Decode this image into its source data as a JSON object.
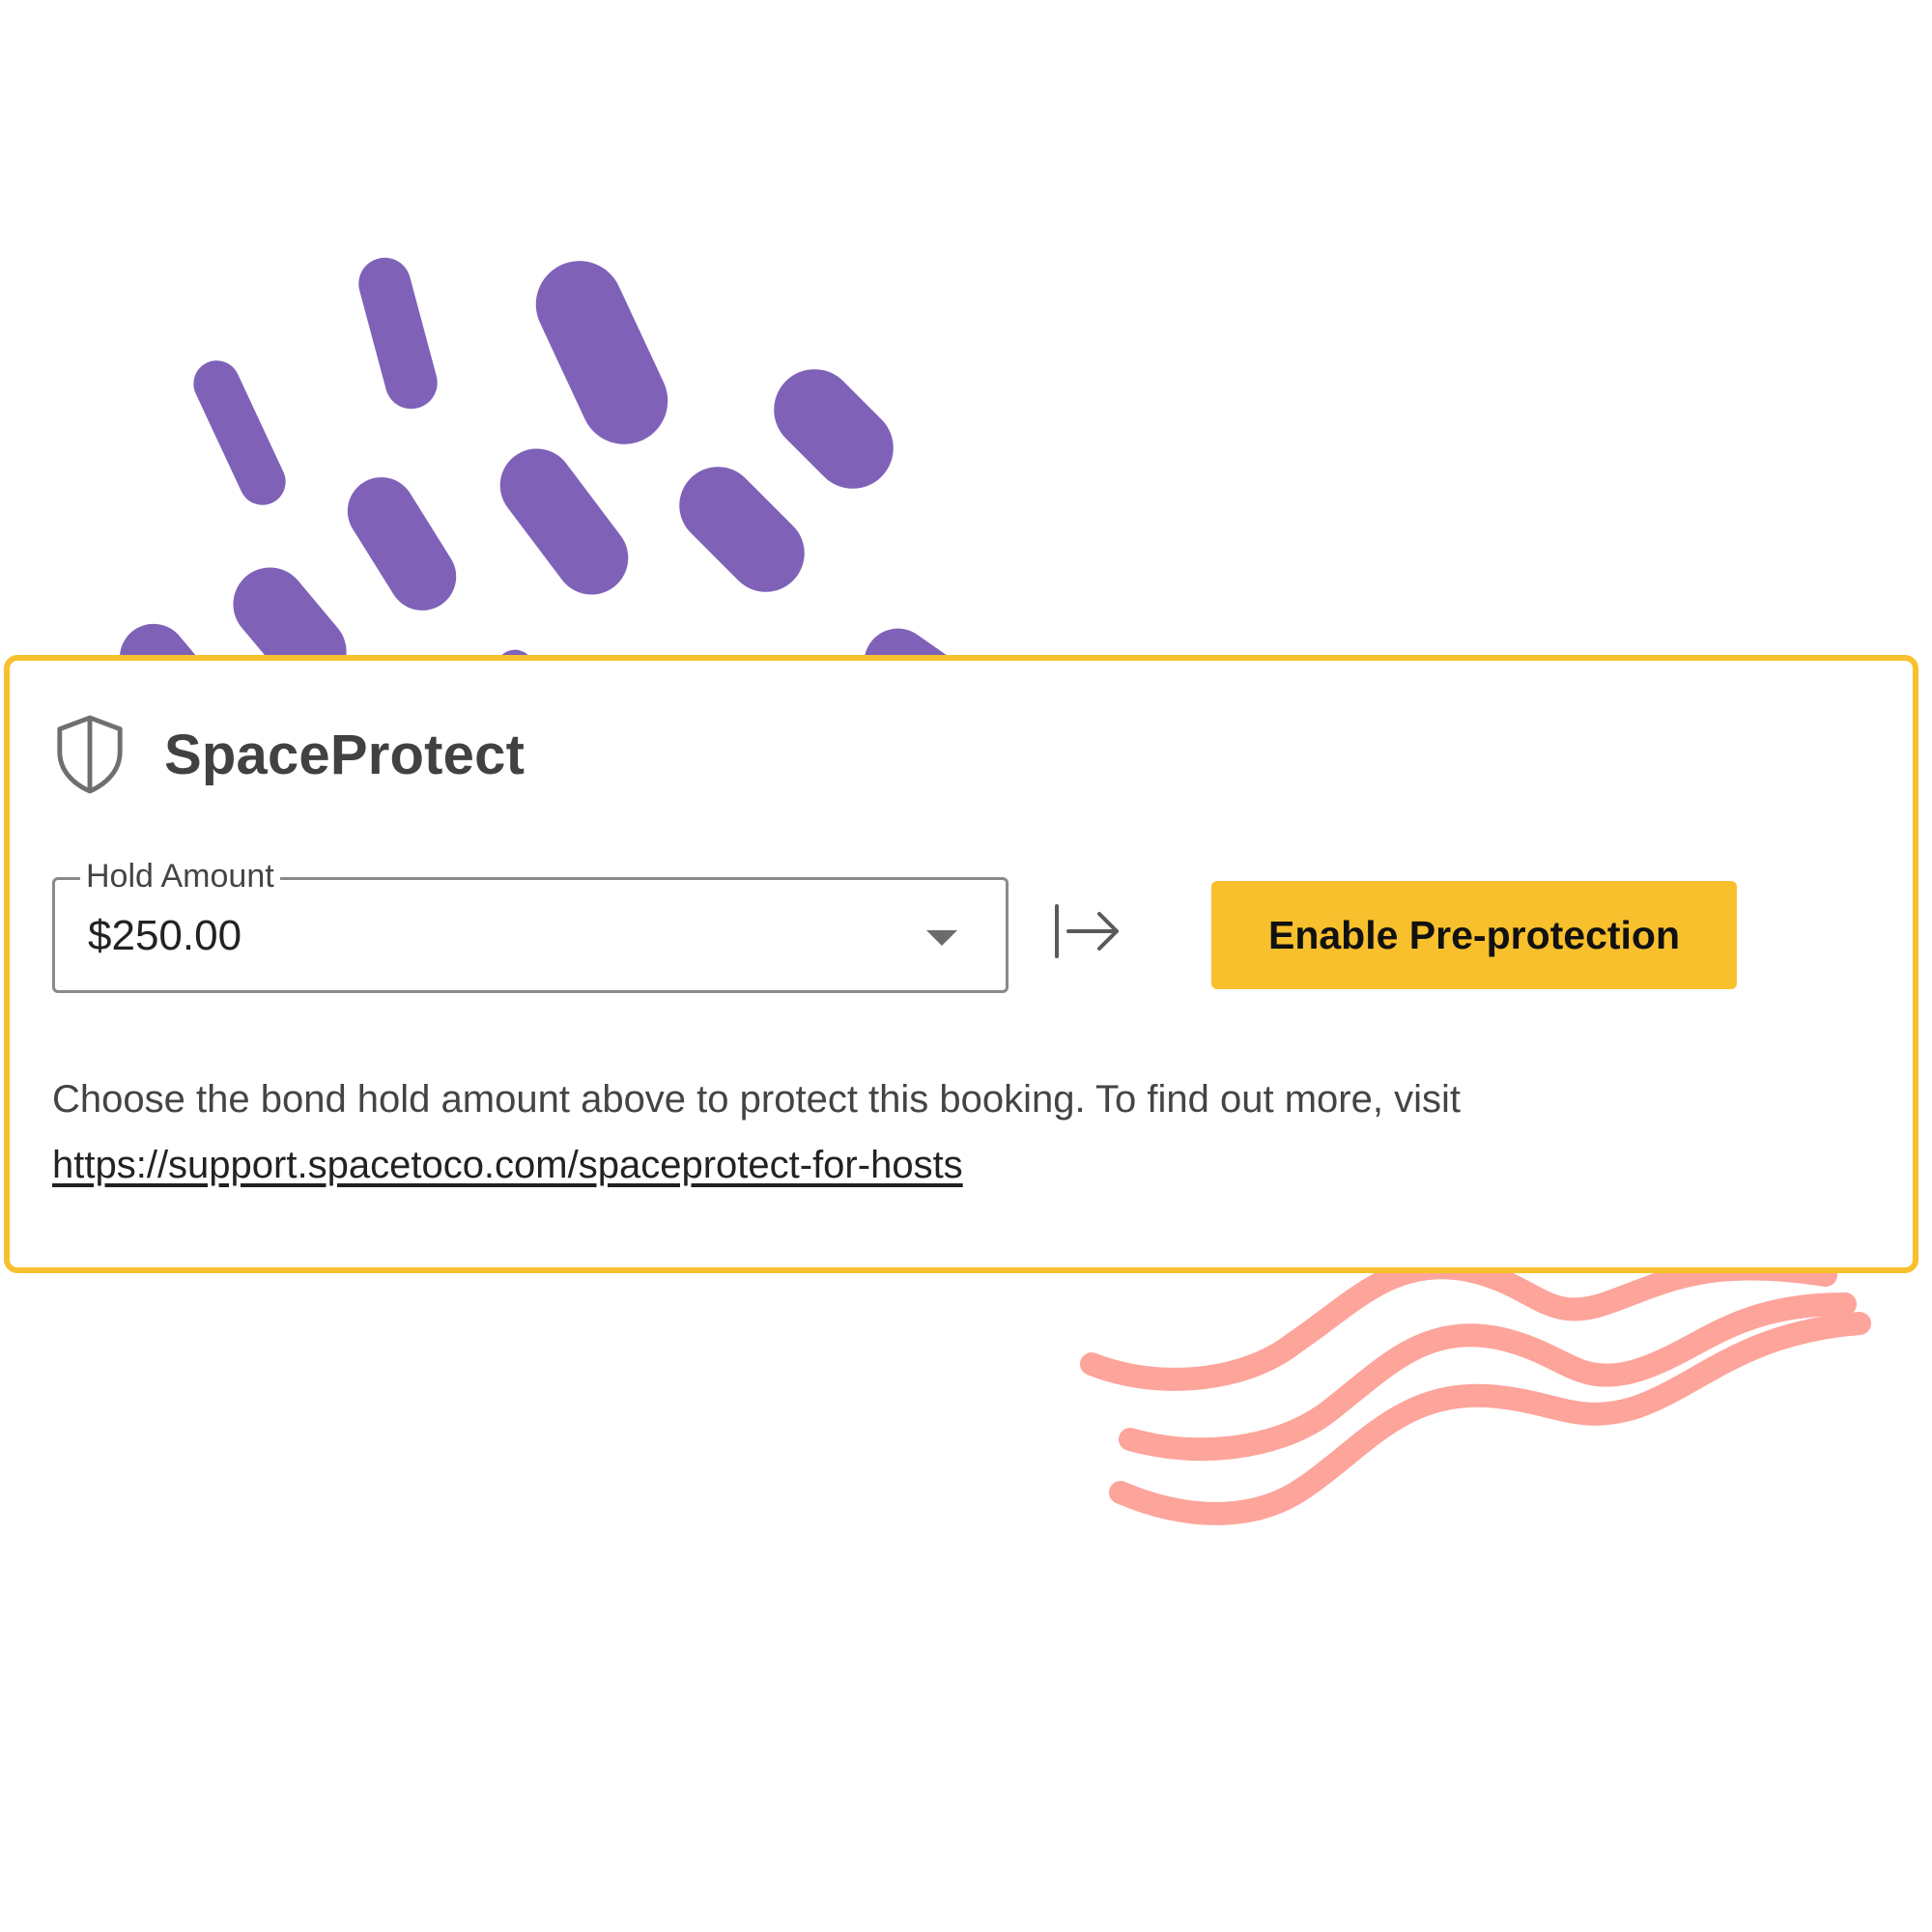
{
  "widget": {
    "title": "SpaceProtect",
    "icon": "shield-icon",
    "hold_amount": {
      "label": "Hold Amount",
      "value": "$250.00"
    },
    "arrow_icon": "arrow-right-to-bar-icon",
    "enable_button_label": "Enable Pre-protection",
    "description": "Choose the bond hold amount above to protect this booking. To find out more, visit",
    "link_text": "https://support.spacetoco.com/spaceprotect-for-hosts"
  },
  "colors": {
    "accent": "#f9c02d",
    "decor_purple": "#7f62b8",
    "decor_pink": "#fda49b",
    "text_dark": "#414141"
  }
}
